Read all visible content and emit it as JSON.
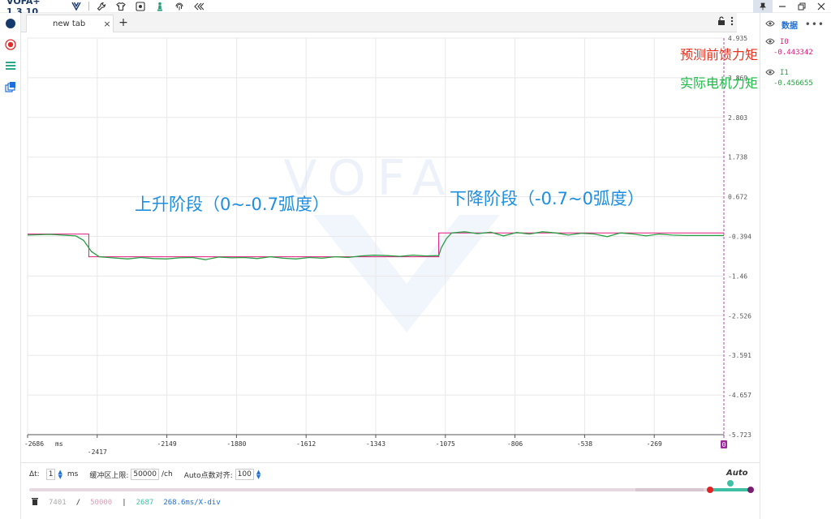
{
  "app": {
    "title": "VOFA+ 1.3.10"
  },
  "tabs": [
    {
      "label": "new tab",
      "close": "×"
    }
  ],
  "tab_add": "+",
  "right_panel": {
    "title": "数据",
    "more": "•••",
    "channels": [
      {
        "name": "I0",
        "value": "-0.443342",
        "color": "#e0197d"
      },
      {
        "name": "I1",
        "value": "-0.456655",
        "color": "#27a043"
      }
    ]
  },
  "annotations": {
    "feedforward": "预测前馈力矩",
    "actual": "实际电机力矩",
    "rise": "上升阶段（0~-0.7弧度）",
    "fall": "下降阶段（-0.7~0弧度）"
  },
  "watermark": "VOFA",
  "colors": {
    "ch0": "#e0197d",
    "ch1": "#27a043",
    "accent": "#1e6fd9",
    "annotation_blue": "#1e8fe0",
    "annotation_red": "#e8311d",
    "annotation_green": "#1cba47"
  },
  "chart_data": {
    "type": "line",
    "title": "",
    "xlabel": "",
    "ylabel": "",
    "x_ticks": [
      "-2686",
      "-2417",
      "-2149",
      "-1880",
      "-1612",
      "-1343",
      "-1075",
      "-806",
      "-538",
      "-269",
      "0"
    ],
    "x_unit": "ms",
    "y_ticks": [
      "4.935",
      "3.869",
      "2.803",
      "1.738",
      "0.672",
      "-0.394",
      "-1.46",
      "-2.526",
      "-3.591",
      "-4.657",
      "-5.723"
    ],
    "xlim": [
      -2686,
      0
    ],
    "ylim": [
      -5.723,
      4.935
    ],
    "grid": true,
    "series": [
      {
        "name": "I0",
        "x": [
          -2686,
          -2450,
          -2450,
          -1100,
          -1100,
          0
        ],
        "values": [
          -0.33,
          -0.33,
          -0.94,
          -0.94,
          -0.3,
          -0.3
        ]
      },
      {
        "name": "I1",
        "x": [
          -2686,
          -2600,
          -2500,
          -2470,
          -2440,
          -2410,
          -2360,
          -2300,
          -2250,
          -2200,
          -2150,
          -2100,
          -2050,
          -2000,
          -1950,
          -1900,
          -1850,
          -1800,
          -1750,
          -1700,
          -1650,
          -1600,
          -1550,
          -1500,
          -1450,
          -1400,
          -1350,
          -1300,
          -1250,
          -1200,
          -1150,
          -1100,
          -1090,
          -1070,
          -1050,
          -1000,
          -950,
          -900,
          -850,
          -800,
          -750,
          -700,
          -650,
          -600,
          -550,
          -500,
          -450,
          -400,
          -350,
          -300,
          -250,
          -200,
          -150,
          -100,
          -50,
          0
        ],
        "values": [
          -0.36,
          -0.34,
          -0.38,
          -0.5,
          -0.8,
          -0.94,
          -0.97,
          -1.0,
          -0.96,
          -0.99,
          -1.0,
          -0.97,
          -0.96,
          -1.02,
          -0.95,
          -0.97,
          -0.96,
          -0.99,
          -0.94,
          -0.98,
          -1.0,
          -0.96,
          -0.98,
          -0.94,
          -0.96,
          -0.92,
          -0.9,
          -0.91,
          -0.93,
          -0.9,
          -0.92,
          -0.91,
          -0.7,
          -0.45,
          -0.3,
          -0.27,
          -0.32,
          -0.28,
          -0.38,
          -0.29,
          -0.33,
          -0.27,
          -0.3,
          -0.36,
          -0.31,
          -0.33,
          -0.4,
          -0.3,
          -0.33,
          -0.38,
          -0.33,
          -0.36,
          -0.37,
          -0.37,
          -0.37,
          -0.37
        ]
      }
    ]
  },
  "bottom": {
    "dt_label": "Δt:",
    "dt_value": "1",
    "dt_unit": "ms",
    "buffer_label": "缓冲区上限:",
    "buffer_value": "50000",
    "buffer_unit": "/ch",
    "auto_align_label": "Auto点数对齐:",
    "auto_align_value": "100",
    "auto": "Auto",
    "stat_count": "7401",
    "stat_sep1": "/",
    "stat_total": "50000",
    "stat_sep2": "|",
    "stat_view": "2687",
    "stat_div": "268.6ms/X-div"
  }
}
